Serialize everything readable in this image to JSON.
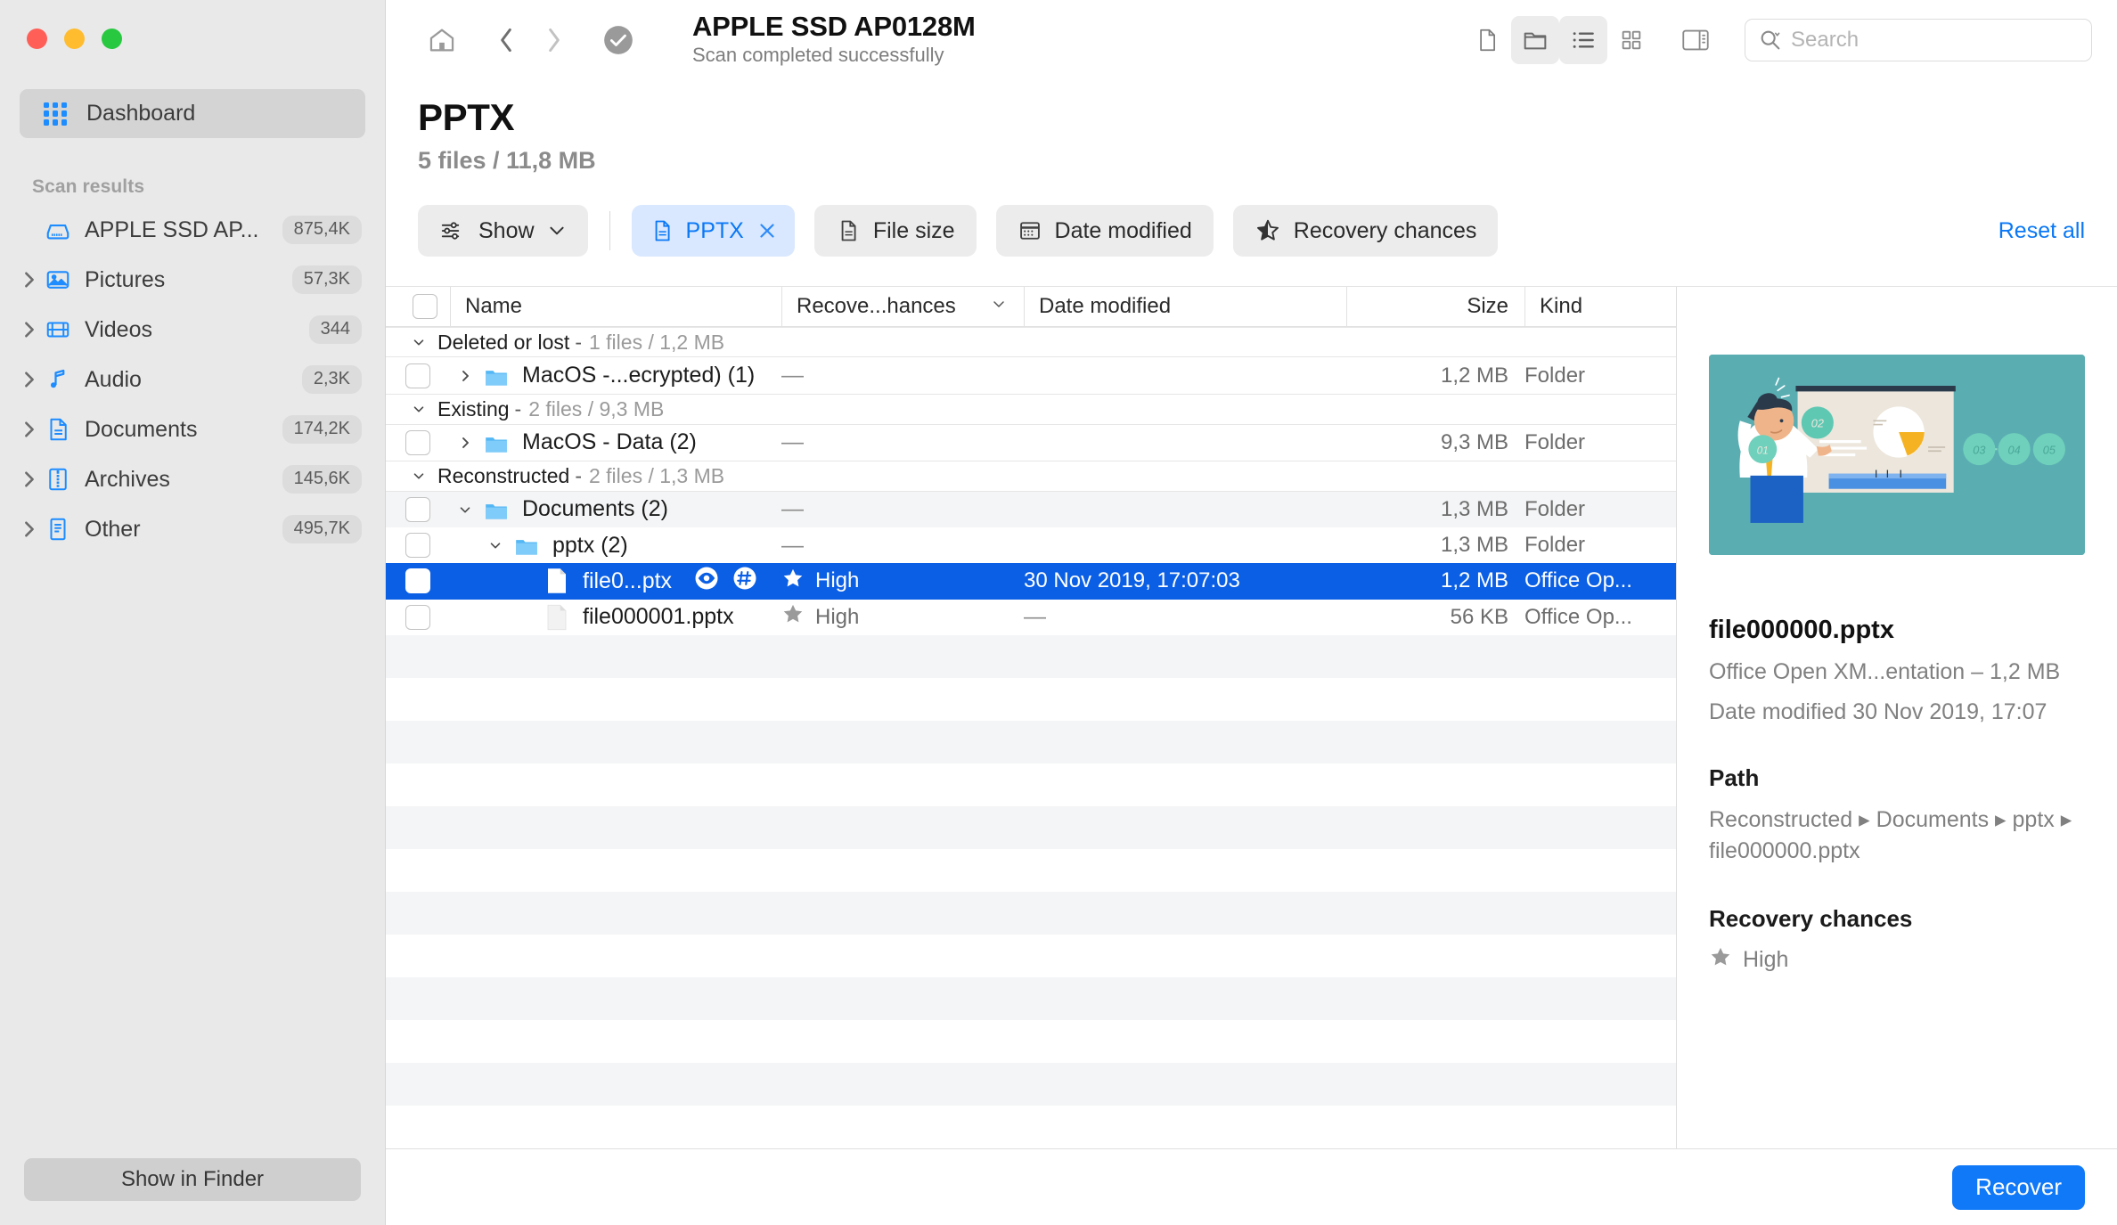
{
  "window": {
    "traffic_lights": [
      "close",
      "minimize",
      "zoom"
    ]
  },
  "sidebar": {
    "dashboard_label": "Dashboard",
    "section_title": "Scan results",
    "items": [
      {
        "label": "APPLE SSD AP...",
        "badge": "875,4K",
        "icon": "disk-icon",
        "expandable": false
      },
      {
        "label": "Pictures",
        "badge": "57,3K",
        "icon": "pictures-icon",
        "expandable": true
      },
      {
        "label": "Videos",
        "badge": "344",
        "icon": "videos-icon",
        "expandable": true
      },
      {
        "label": "Audio",
        "badge": "2,3K",
        "icon": "audio-icon",
        "expandable": true
      },
      {
        "label": "Documents",
        "badge": "174,2K",
        "icon": "documents-icon",
        "expandable": true
      },
      {
        "label": "Archives",
        "badge": "145,6K",
        "icon": "archives-icon",
        "expandable": true
      },
      {
        "label": "Other",
        "badge": "495,7K",
        "icon": "other-icon",
        "expandable": true
      }
    ],
    "show_in_finder_label": "Show in Finder"
  },
  "toolbar": {
    "home_icon": "home-icon",
    "back_icon": "chevron-left-icon",
    "forward_icon": "chevron-right-icon",
    "status_icon": "check-circle-icon",
    "disk_title": "APPLE SSD AP0128M",
    "disk_subtitle": "Scan completed successfully",
    "view_buttons": [
      {
        "name": "file-view-icon",
        "active": false
      },
      {
        "name": "folder-view-icon",
        "active": true
      },
      {
        "name": "list-view-icon",
        "active": true
      },
      {
        "name": "grid-view-icon",
        "active": false
      },
      {
        "name": "sidebar-toggle-icon",
        "active": false
      }
    ],
    "search_placeholder": "Search",
    "search_value": ""
  },
  "page": {
    "title": "PPTX",
    "subtitle": "5 files / 11,8 MB"
  },
  "filters": {
    "show_label": "Show",
    "chips": [
      {
        "label": "PPTX",
        "icon": "document-icon",
        "active": true,
        "removable": true
      },
      {
        "label": "File size",
        "icon": "document-icon",
        "active": false,
        "removable": false
      },
      {
        "label": "Date modified",
        "icon": "calendar-icon",
        "active": false,
        "removable": false
      },
      {
        "label": "Recovery chances",
        "icon": "star-icon",
        "active": false,
        "removable": false
      }
    ],
    "reset_label": "Reset all",
    "accent_color": "#0a78f5"
  },
  "table": {
    "columns": [
      "Name",
      "Recove...hances",
      "Date modified",
      "Size",
      "Kind"
    ],
    "groups": [
      {
        "name": "Deleted or lost",
        "meta": "1 files / 1,2 MB",
        "rows": [
          {
            "name": "MacOS -...ecrypted) (1)",
            "icon": "folder-icon",
            "expandable": true,
            "expanded": false,
            "indent": 0,
            "chance": "",
            "date": "—",
            "size": "1,2 MB",
            "kind": "Folder",
            "selected": false,
            "alt": false
          }
        ]
      },
      {
        "name": "Existing",
        "meta": "2 files / 9,3 MB",
        "rows": [
          {
            "name": "MacOS - Data (2)",
            "icon": "folder-icon",
            "expandable": true,
            "expanded": false,
            "indent": 0,
            "chance": "",
            "date": "—",
            "size": "9,3 MB",
            "kind": "Folder",
            "selected": false,
            "alt": false
          }
        ]
      },
      {
        "name": "Reconstructed",
        "meta": "2 files / 1,3 MB",
        "rows": [
          {
            "name": "Documents (2)",
            "icon": "folder-icon",
            "expandable": true,
            "expanded": true,
            "indent": 0,
            "chance": "",
            "date": "—",
            "size": "1,3 MB",
            "kind": "Folder",
            "selected": false,
            "alt": true
          },
          {
            "name": "pptx (2)",
            "icon": "folder-icon",
            "expandable": true,
            "expanded": true,
            "indent": 1,
            "chance": "",
            "date": "—",
            "size": "1,3 MB",
            "kind": "Folder",
            "selected": false,
            "alt": false
          },
          {
            "name": "file0...ptx",
            "icon": "file-icon",
            "expandable": false,
            "expanded": false,
            "indent": 2,
            "chance": "High",
            "date": "30 Nov 2019, 17:07:03",
            "size": "1,2 MB",
            "kind": "Office Op...",
            "selected": true,
            "alt": false,
            "inline_icons": [
              "eye-icon",
              "hash-icon"
            ]
          },
          {
            "name": "file000001.pptx",
            "icon": "file-icon-dim",
            "expandable": false,
            "expanded": false,
            "indent": 2,
            "chance": "High",
            "date": "—",
            "size": "56 KB",
            "kind": "Office Op...",
            "selected": false,
            "alt": false
          }
        ]
      }
    ]
  },
  "detail": {
    "thumbnail_name": "presentation-thumbnail",
    "file_name": "file000000.pptx",
    "type_and_size": "Office Open XM...entation – 1,2 MB",
    "date_modified": "Date modified  30 Nov 2019, 17:07",
    "path_heading": "Path",
    "path_value": "Reconstructed ▸ Documents ▸ pptx ▸ file000000.pptx",
    "chances_heading": "Recovery chances",
    "chances_value": "High"
  },
  "footer": {
    "recover_label": "Recover"
  }
}
